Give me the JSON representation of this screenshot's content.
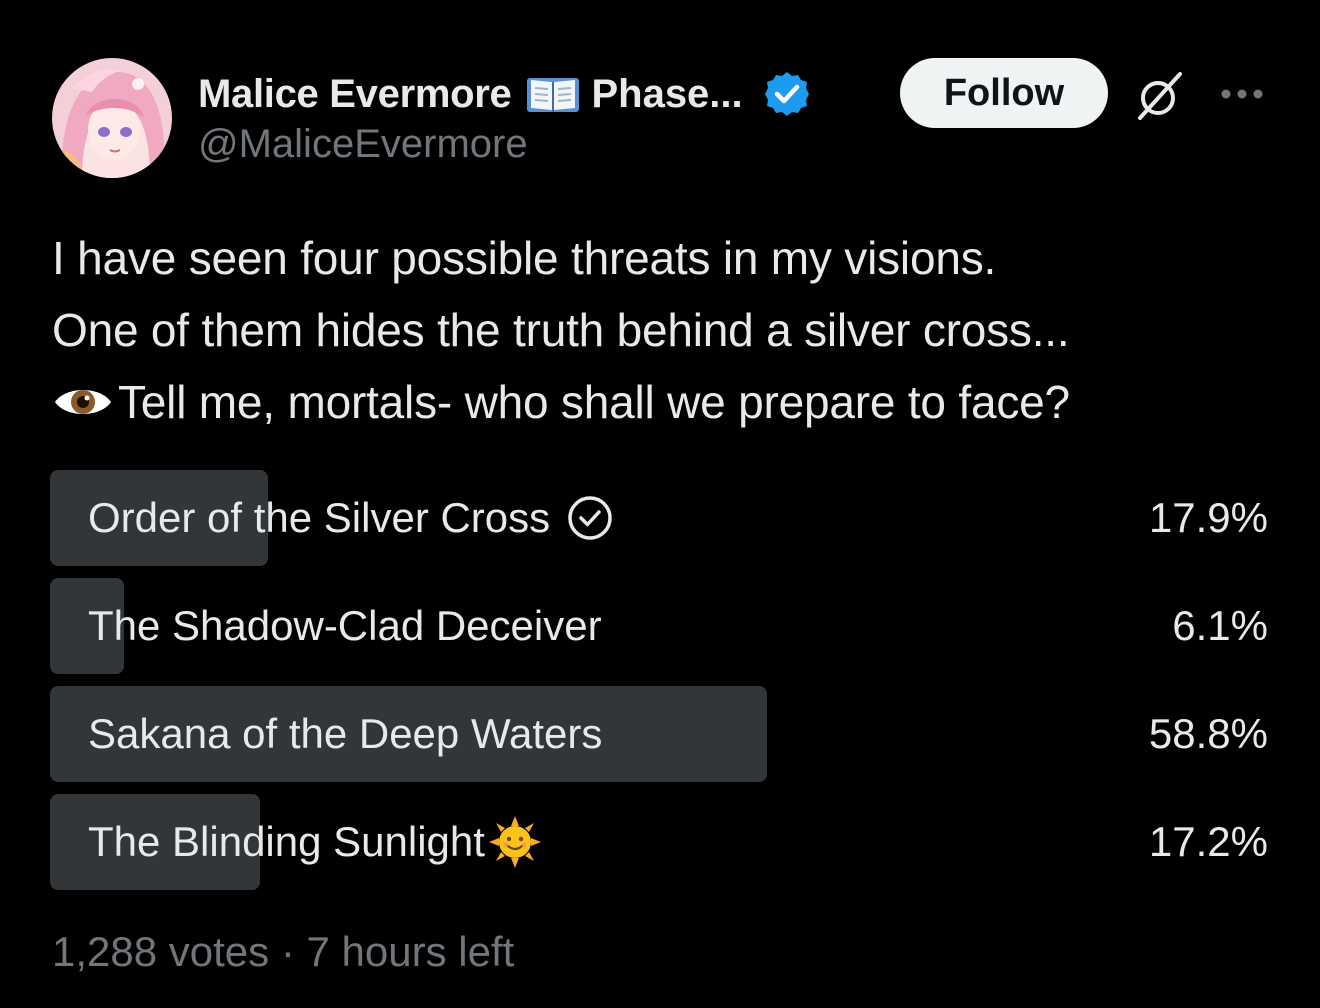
{
  "author": {
    "display_name": "Malice Evermore",
    "name_suffix": "Phase...",
    "handle": "@MaliceEvermore",
    "avatar_icon": "avatar-pink-haired-character",
    "verified_color": "#1d9bf0"
  },
  "actions": {
    "follow_label": "Follow",
    "grok_icon": "grok-icon",
    "more_icon": "more-icon"
  },
  "tweet": {
    "line1": "I have seen four possible threats in my visions.",
    "line2": "One of them hides the truth behind a silver cross...",
    "line3": "Tell me, mortals- who shall we prepare to face?"
  },
  "poll": {
    "options": [
      {
        "label": "Order of the Silver Cross",
        "percent_label": "17.9%",
        "percent": 17.9,
        "selected": true
      },
      {
        "label": "The Shadow-Clad Deceiver",
        "percent_label": "6.1%",
        "percent": 6.1,
        "selected": false
      },
      {
        "label": "Sakana of the Deep Waters",
        "percent_label": "58.8%",
        "percent": 58.8,
        "selected": false
      },
      {
        "label": "The Blinding Sunlight",
        "percent_label": "17.2%",
        "percent": 17.2,
        "selected": false
      }
    ],
    "votes": "1,288 votes",
    "separator": "·",
    "time_left": "7 hours left",
    "bar_color": "#333639"
  }
}
